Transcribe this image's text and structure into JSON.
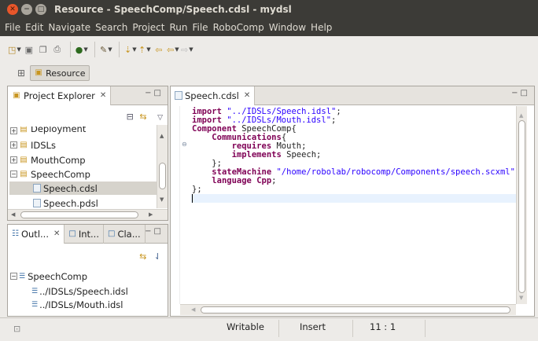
{
  "window": {
    "title": "Resource - SpeechComp/Speech.cdsl - mydsl"
  },
  "menu": [
    "File",
    "Edit",
    "Navigate",
    "Search",
    "Project",
    "Run",
    "File",
    "RoboComp",
    "Window",
    "Help"
  ],
  "perspective": {
    "label": "Resource"
  },
  "project_explorer": {
    "tab_label": "Project Explorer",
    "items": [
      {
        "label": "Deployment",
        "expanded": false
      },
      {
        "label": "IDSLs",
        "expanded": false
      },
      {
        "label": "MouthComp",
        "expanded": false
      },
      {
        "label": "SpeechComp",
        "expanded": true
      },
      {
        "label": "Speech.cdsl",
        "selected": true
      },
      {
        "label": "Speech.pdsl"
      }
    ]
  },
  "outline": {
    "tabs": [
      "Outl...",
      "Int...",
      "Cla..."
    ],
    "items": [
      {
        "label": "SpeechComp"
      },
      {
        "label": "../IDSLs/Speech.idsl"
      },
      {
        "label": "../IDSLs/Mouth.idsl"
      }
    ]
  },
  "editor": {
    "tab_label": "Speech.cdsl",
    "lines": [
      {
        "indent": "",
        "parts": [
          {
            "t": "import",
            "c": "kw"
          },
          {
            "t": " ",
            "c": ""
          },
          {
            "t": "\"../IDSLs/Speech.idsl\"",
            "c": "str"
          },
          {
            "t": ";",
            "c": ""
          }
        ]
      },
      {
        "indent": "",
        "parts": [
          {
            "t": "import",
            "c": "kw"
          },
          {
            "t": " ",
            "c": ""
          },
          {
            "t": "\"../IDSLs/Mouth.idsl\"",
            "c": "str"
          },
          {
            "t": ";",
            "c": ""
          }
        ]
      },
      {
        "indent": "",
        "parts": [
          {
            "t": "Component",
            "c": "kw"
          },
          {
            "t": " SpeechComp{",
            "c": ""
          }
        ]
      },
      {
        "indent": "    ",
        "parts": [
          {
            "t": "Communications",
            "c": "kw"
          },
          {
            "t": "{",
            "c": ""
          }
        ]
      },
      {
        "indent": "        ",
        "parts": [
          {
            "t": "requires",
            "c": "kw"
          },
          {
            "t": " Mouth;",
            "c": ""
          }
        ]
      },
      {
        "indent": "        ",
        "parts": [
          {
            "t": "implements",
            "c": "kw"
          },
          {
            "t": " Speech;",
            "c": ""
          }
        ]
      },
      {
        "indent": "    ",
        "parts": [
          {
            "t": "};",
            "c": ""
          }
        ]
      },
      {
        "indent": "    ",
        "parts": [
          {
            "t": "stateMachine",
            "c": "kw"
          },
          {
            "t": " ",
            "c": ""
          },
          {
            "t": "\"/home/robolab/robocomp/Components/speech.scxml\"",
            "c": "str"
          },
          {
            "t": ";",
            "c": ""
          }
        ]
      },
      {
        "indent": "    ",
        "parts": [
          {
            "t": "language",
            "c": "kw"
          },
          {
            "t": " ",
            "c": ""
          },
          {
            "t": "Cpp",
            "c": "kw"
          },
          {
            "t": ";",
            "c": ""
          }
        ]
      },
      {
        "indent": "",
        "parts": [
          {
            "t": "};",
            "c": ""
          }
        ]
      }
    ]
  },
  "status": {
    "mode": "Writable",
    "insert": "Insert",
    "position": "11 : 1"
  }
}
